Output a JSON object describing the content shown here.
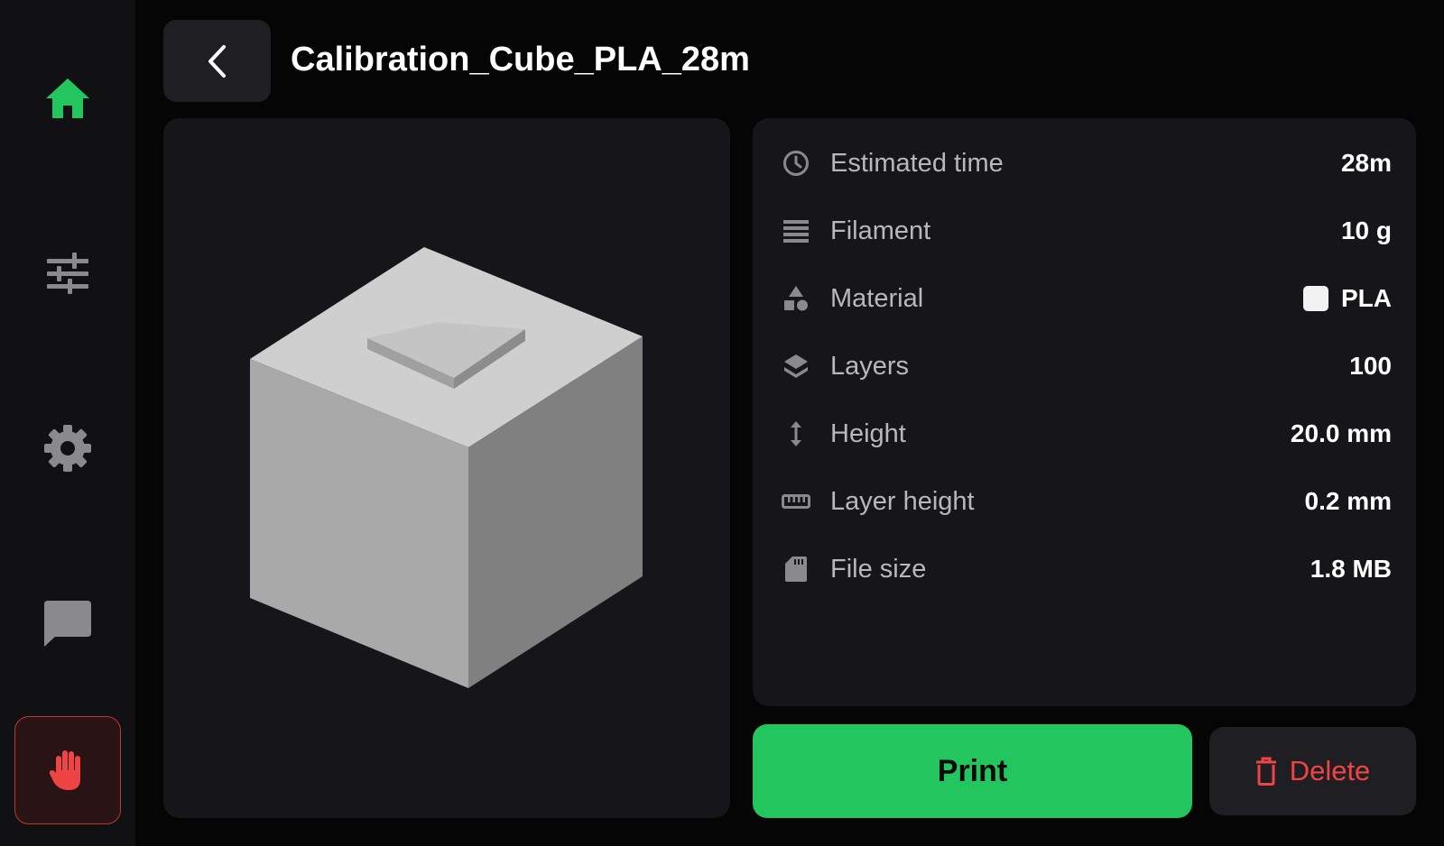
{
  "header": {
    "title": "Calibration_Cube_PLA_28m",
    "back_icon": "chevron-left-icon"
  },
  "sidebar": {
    "items": [
      {
        "name": "home",
        "icon": "home-icon",
        "active": true,
        "color": "#22c55e"
      },
      {
        "name": "tune",
        "icon": "sliders-icon",
        "active": false
      },
      {
        "name": "settings",
        "icon": "gear-icon",
        "active": false
      },
      {
        "name": "console",
        "icon": "chat-icon",
        "active": false
      },
      {
        "name": "emergency-stop",
        "icon": "hand-stop-icon",
        "color": "#ef4444"
      }
    ]
  },
  "details": {
    "estimated_time": {
      "label": "Estimated time",
      "value": "28m",
      "icon": "clock-icon"
    },
    "filament": {
      "label": "Filament",
      "value": "10 g",
      "icon": "filament-lines-icon"
    },
    "material": {
      "label": "Material",
      "value": "PLA",
      "icon": "shapes-icon",
      "swatch_color": "#f2f2f2"
    },
    "layers": {
      "label": "Layers",
      "value": "100",
      "icon": "layers-icon"
    },
    "height": {
      "label": "Height",
      "value": "20.0 mm",
      "icon": "vertical-arrows-icon"
    },
    "layer_height": {
      "label": "Layer height",
      "value": "0.2 mm",
      "icon": "ruler-icon"
    },
    "file_size": {
      "label": "File size",
      "value": "1.8 MB",
      "icon": "sd-card-icon"
    }
  },
  "actions": {
    "print_label": "Print",
    "delete_label": "Delete",
    "print_color": "#22c55e",
    "delete_color": "#ef4444"
  }
}
